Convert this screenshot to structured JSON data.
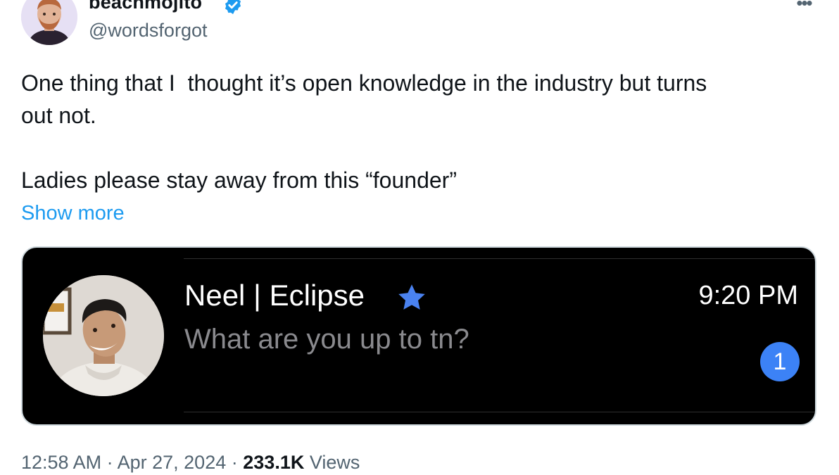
{
  "author": {
    "display_name": "beachmojito",
    "handle": "@wordsforgot",
    "verified_icon": "verified-badge-icon",
    "verified_color": "#1d9bf0"
  },
  "more_icon": "ellipsis-icon",
  "tweet": {
    "text": "One thing that I  thought it’s open knowledge in the industry but turns\nout not.\n\nLadies please stay away from this “founder”",
    "show_more": "Show more"
  },
  "media": {
    "contact_name": "Neel | Eclipse",
    "star_icon": "star-icon",
    "star_color": "#4a82f0",
    "time": "9:20 PM",
    "preview": "What are you up to tn?",
    "unread_count": "1",
    "badge_color": "#3c82f6",
    "background": "#000000"
  },
  "meta": {
    "time": "12:58 AM",
    "separator": "·",
    "date": "Apr 27, 2024",
    "views_count": "233.1K",
    "views_label": "Views"
  },
  "colors": {
    "text": "#0f1419",
    "secondary": "#536471",
    "link": "#1d9bf0"
  }
}
